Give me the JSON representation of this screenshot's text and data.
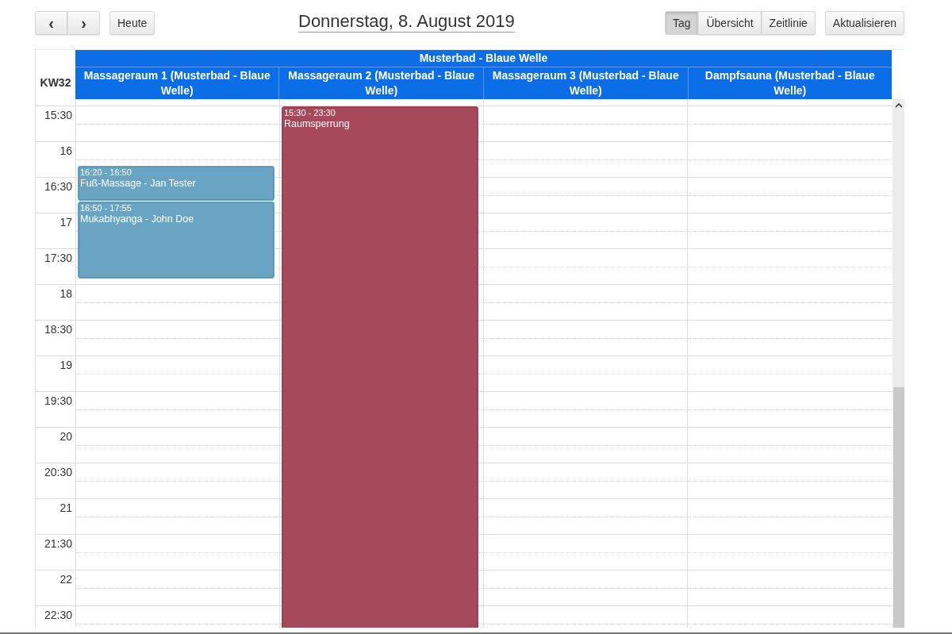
{
  "toolbar": {
    "prev_label": "‹",
    "next_label": "›",
    "today_label": "Heute",
    "title": "Donnerstag, 8. August 2019",
    "views": [
      {
        "label": "Tag",
        "selected": true
      },
      {
        "label": "Übersicht",
        "selected": false
      },
      {
        "label": "Zeitlinie",
        "selected": false
      }
    ],
    "refresh_label": "Aktualisieren"
  },
  "calendar": {
    "week": "KW32",
    "group": "Musterbad - Blaue Welle",
    "columns": [
      {
        "title": "Massageraum 1 (Musterbad - Blaue Welle)",
        "events": [
          {
            "time": "16:20 - 16:50",
            "title": "Fuß-Massage - Jan Tester",
            "color": "#6aa4c3"
          },
          {
            "time": "16:50 - 17:55",
            "title": "Mukabhyanga - John Doe",
            "color": "#6aa4c3"
          }
        ]
      },
      {
        "title": "Massageraum 2 (Musterbad - Blaue Welle)",
        "events": [
          {
            "time": "15:30 - 23:30",
            "title": "Raumsperrung",
            "color": "#a5495b"
          }
        ]
      },
      {
        "title": "Massageraum 3 (Musterbad - Blaue Welle)"
      },
      {
        "title": "Dampfsauna (Musterbad - Blaue Welle)"
      }
    ],
    "times": [
      "15:30",
      "16",
      "16:30",
      "17",
      "17:30",
      "18",
      "18:30",
      "19",
      "19:30",
      "20",
      "20:30",
      "21",
      "21:30",
      "22",
      "22:30"
    ]
  }
}
